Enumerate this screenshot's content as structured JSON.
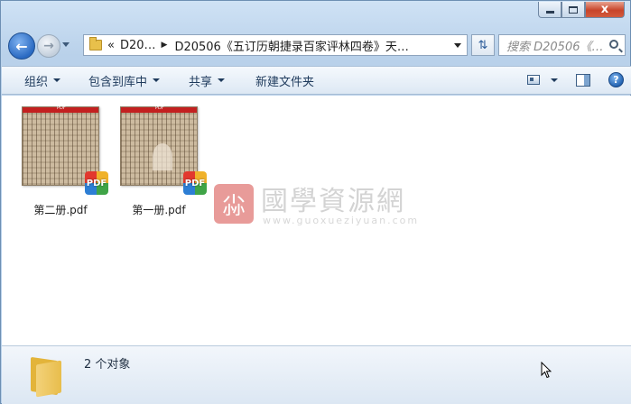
{
  "window": {
    "caption_close": "x"
  },
  "nav": {
    "breadcrumb_overflow": "«",
    "crumb_1": "D20…",
    "crumb_2": "D20506《五订历朝捷录百家评林四卷》天…",
    "search_placeholder": "搜索 D20506《…"
  },
  "toolbar": {
    "organize": "组织",
    "include_in_library": "包含到库中",
    "share": "共享",
    "new_folder": "新建文件夹",
    "help": "?"
  },
  "files": [
    {
      "name": "第二册.pdf",
      "badge": "PDF",
      "thumb_label": "PDF"
    },
    {
      "name": "第一册.pdf",
      "badge": "PDF",
      "thumb_label": "PDF"
    }
  ],
  "watermark": {
    "seal": "尛",
    "name": "國學資源網",
    "url": "www.guoxueziyuan.com"
  },
  "status": {
    "count_text": "2 个对象"
  },
  "colors": {
    "accent": "#2a6ac2",
    "close_button": "#c8442a",
    "pdf_header": "#c32020"
  }
}
